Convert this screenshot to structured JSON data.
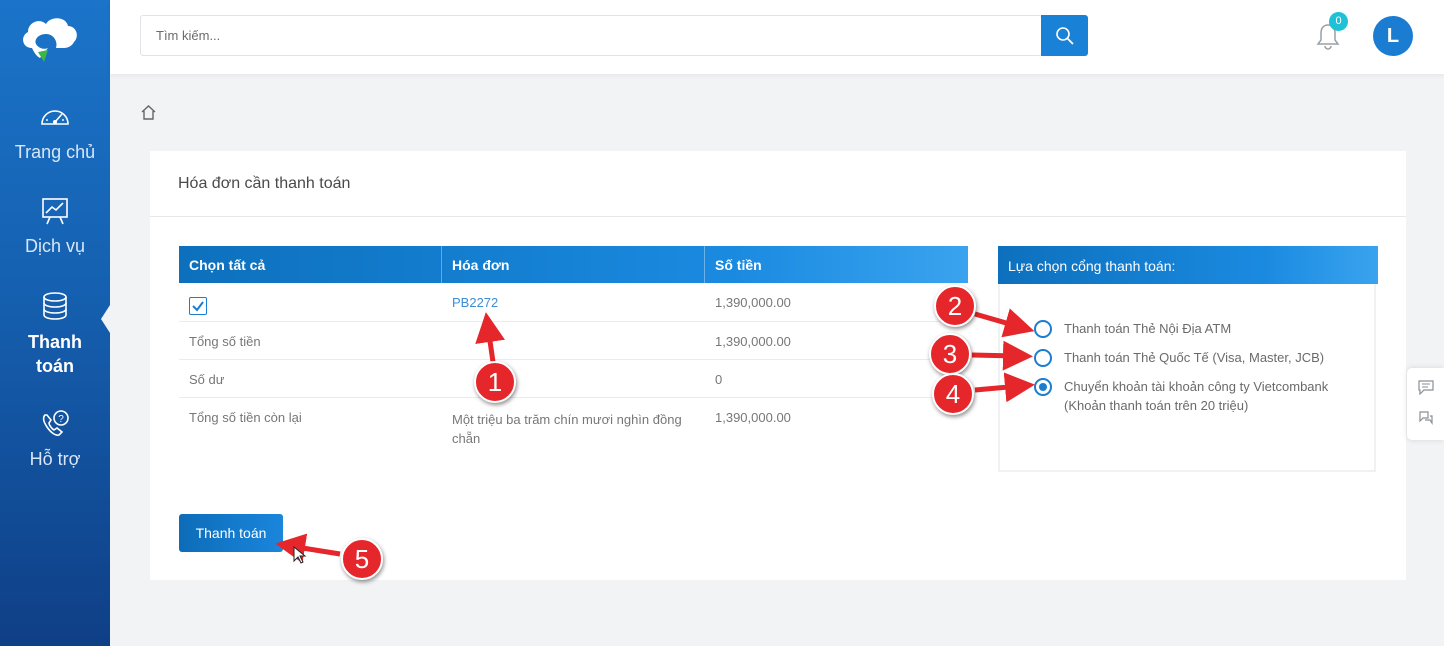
{
  "sidebar": {
    "items": [
      {
        "label": "Trang chủ",
        "icon": "speedometer-icon"
      },
      {
        "label": "Dịch vụ",
        "icon": "chart-board-icon"
      },
      {
        "label_line1": "Thanh",
        "label_line2": "toán",
        "icon": "coins-icon",
        "active": true
      },
      {
        "label": "Hỗ trợ",
        "icon": "support-phone-icon"
      }
    ]
  },
  "header": {
    "search_placeholder": "Tìm kiếm...",
    "notification_count": "0",
    "avatar_initial": "L"
  },
  "card": {
    "title": "Hóa đơn cần thanh toán",
    "table": {
      "headers": [
        "Chọn tất cả",
        "Hóa đơn",
        "Số tiền"
      ],
      "rows": [
        {
          "label": "",
          "invoice": "PB2272",
          "amount": "1,390,000.00",
          "checked": true
        },
        {
          "label": "Tổng số tiền",
          "invoice": "",
          "amount": "1,390,000.00"
        },
        {
          "label": "Số dư",
          "invoice": "",
          "amount": "0"
        },
        {
          "label": "Tổng số tiền còn lại",
          "invoice_words": "Một triệu ba trăm chín mươi nghìn đồng chẵn",
          "amount": "1,390,000.00"
        }
      ]
    },
    "gateway": {
      "title": "Lựa chọn cổng thanh toán:",
      "options": [
        {
          "label": "Thanh toán Thẻ Nội Địa ATM",
          "selected": false
        },
        {
          "label": "Thanh toán Thẻ Quốc Tế (Visa, Master, JCB)",
          "selected": false
        },
        {
          "label": "Chuyển khoản tài khoản công ty Vietcombank (Khoản thanh toán trên 20 triệu)",
          "selected": true
        }
      ]
    },
    "pay_button": "Thanh toán"
  },
  "annotations": [
    "1",
    "2",
    "3",
    "4",
    "5"
  ],
  "colors": {
    "primary": "#1a7dd1",
    "annotation": "#e5262a",
    "sidebar": "#1560b0"
  }
}
